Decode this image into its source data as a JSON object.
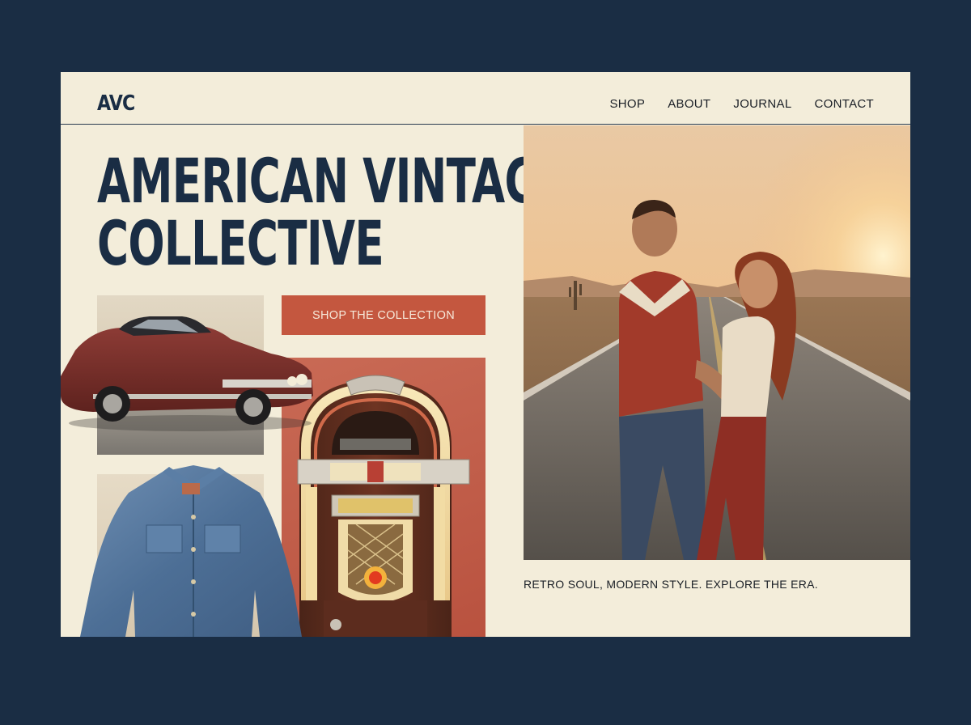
{
  "brand": {
    "logo_text": "AVC"
  },
  "nav": {
    "items": [
      {
        "label": "SHOP"
      },
      {
        "label": "ABOUT"
      },
      {
        "label": "JOURNAL"
      },
      {
        "label": "CONTACT"
      }
    ]
  },
  "hero": {
    "title_line1": "AMERICAN VINTAGE",
    "title_line2": "COLLECTIVE",
    "cta_label": "SHOP THE COLLECTION",
    "caption": "RETRO SOUL, MODERN STYLE. EXPLORE THE ERA."
  },
  "colors": {
    "background": "#1a2d44",
    "page": "#f3edda",
    "navy": "#1a2d44",
    "accent": "#c4573f"
  }
}
